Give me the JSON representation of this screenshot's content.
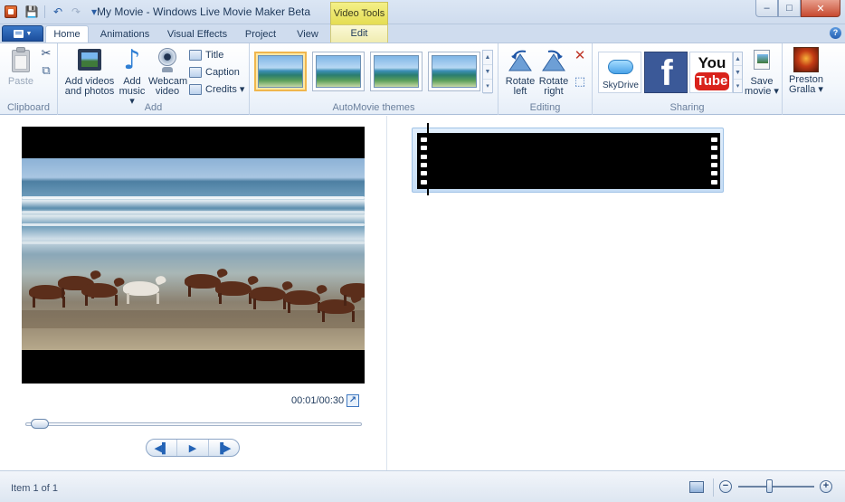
{
  "window": {
    "title": "My Movie - Windows Live Movie Maker Beta",
    "context_tab_group": "Video Tools",
    "controls": {
      "minimize": "–",
      "maximize": "□",
      "close": "✕"
    }
  },
  "quick_access": {
    "save_icon": "💾",
    "undo_icon": "↶",
    "redo_icon": "↷",
    "customize_icon": "▾"
  },
  "tabs": [
    {
      "label": "Home",
      "active": true
    },
    {
      "label": "Animations"
    },
    {
      "label": "Visual Effects"
    },
    {
      "label": "Project"
    },
    {
      "label": "View"
    },
    {
      "label": "Edit",
      "contextual": true
    }
  ],
  "help_label": "?",
  "ribbon": {
    "clipboard": {
      "label": "Clipboard",
      "paste": "Paste",
      "cut_icon": "✂",
      "copy_icon": "⧉"
    },
    "add": {
      "label": "Add",
      "add_videos": [
        "Add videos",
        "and photos"
      ],
      "add_music": [
        "Add",
        "music ▾"
      ],
      "webcam": [
        "Webcam",
        "video"
      ],
      "title": "Title",
      "caption": "Caption",
      "credits": "Credits ▾"
    },
    "themes": {
      "label": "AutoMovie themes",
      "up": "▲",
      "down": "▼",
      "more": "▾"
    },
    "editing": {
      "label": "Editing",
      "rotate_left": [
        "Rotate",
        "left"
      ],
      "rotate_right": [
        "Rotate",
        "right"
      ],
      "remove_icon": "✕",
      "select_all_icon": "⬚"
    },
    "sharing": {
      "label": "Sharing",
      "skydrive": "SkyDrive",
      "facebook_glyph": "f",
      "youtube_you": "You",
      "youtube_tube": "Tube",
      "save_movie": [
        "Save",
        "movie ▾"
      ],
      "more": "▾"
    },
    "account": {
      "name": [
        "Preston",
        "Gralla ▾"
      ]
    }
  },
  "preview": {
    "time": "00:01/00:30",
    "fullscreen_icon": "↗",
    "transport": {
      "prev": "◀▌",
      "play": "▶",
      "next": "▐▶"
    }
  },
  "status": {
    "text": "Item 1 of 1",
    "zoom_out": "−",
    "zoom_in": "+"
  },
  "colors": {
    "accent": "#2a63b0",
    "ribbon_text": "#1e395b",
    "group_label": "#6a7f9c"
  }
}
